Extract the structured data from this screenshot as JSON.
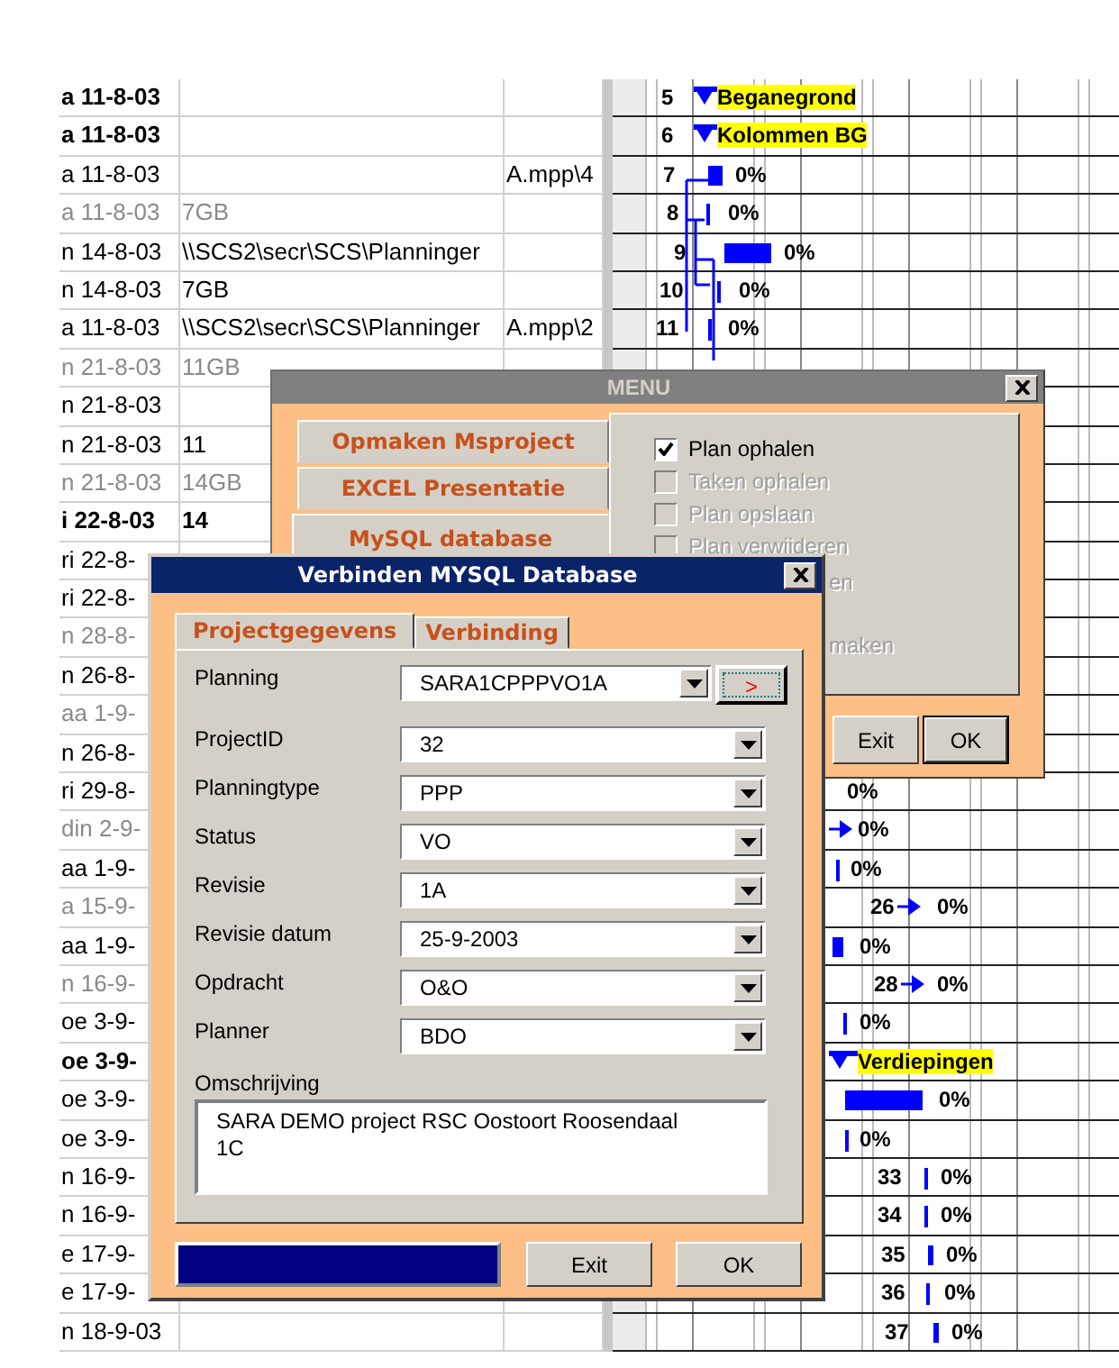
{
  "sheet": {
    "rows": [
      {
        "kind": "bold",
        "date": "a 11-8-03",
        "gantt": {
          "kind": "summary",
          "id": "5",
          "label": "Beganegrond"
        }
      },
      {
        "kind": "bold",
        "date": "a 11-8-03",
        "gantt": {
          "kind": "summary",
          "id": "6",
          "label": "Kolommen BG"
        }
      },
      {
        "kind": "plain",
        "date": "a 11-8-03",
        "file": "A.mpp\\4",
        "gantt": {
          "kind": "bar",
          "id": "7",
          "percent": "0%"
        }
      },
      {
        "kind": "dim",
        "date": "a 11-8-03",
        "path": "7GB",
        "gantt": {
          "kind": "tick",
          "id": "8",
          "percent": "0%"
        }
      },
      {
        "kind": "plain",
        "date": "n 14-8-03",
        "path": "\\\\SCS2\\secr\\SCS\\Planninger",
        "gantt": {
          "kind": "bar",
          "id": "9",
          "percent": "0%"
        }
      },
      {
        "kind": "plain",
        "date": "n 14-8-03",
        "path": "7GB",
        "gantt": {
          "kind": "tick",
          "id": "10",
          "percent": "0%"
        }
      },
      {
        "kind": "plain",
        "date": "a 11-8-03",
        "path": "\\\\SCS2\\secr\\SCS\\Planninger",
        "file": "A.mpp\\2",
        "gantt": {
          "kind": "tick",
          "id": "11",
          "percent": "0%"
        }
      },
      {
        "kind": "dim",
        "date": "n 21-8-03",
        "path": "11GB"
      },
      {
        "kind": "plain",
        "date": "n 21-8-03"
      },
      {
        "kind": "plain",
        "date": "n 21-8-03",
        "path": "11"
      },
      {
        "kind": "dim",
        "date": "n 21-8-03",
        "path": "14GB"
      },
      {
        "kind": "bold",
        "date": "i 22-8-03",
        "path": "14"
      },
      {
        "kind": "plain",
        "date": "ri 22-8-"
      },
      {
        "kind": "plain",
        "date": "ri 22-8-"
      },
      {
        "kind": "dim",
        "date": "n 28-8-"
      },
      {
        "kind": "plain",
        "date": "n 26-8-"
      },
      {
        "kind": "dim",
        "date": "aa 1-9-"
      },
      {
        "kind": "plain",
        "date": "n 26-8-"
      },
      {
        "kind": "plain",
        "date": "ri 29-8-",
        "gantt": {
          "kind": "none",
          "percent": "0%"
        }
      },
      {
        "kind": "dim",
        "date": "din 2-9-",
        "gantt": {
          "kind": "arrow",
          "percent": "0%"
        }
      },
      {
        "kind": "plain",
        "date": "aa 1-9-",
        "gantt": {
          "kind": "tick",
          "percent": "0%"
        }
      },
      {
        "kind": "dim",
        "date": "a 15-9-",
        "gantt": {
          "kind": "arrow",
          "id": "26",
          "percent": "0%"
        }
      },
      {
        "kind": "plain",
        "date": "aa 1-9-",
        "gantt": {
          "kind": "bar",
          "percent": "0%"
        }
      },
      {
        "kind": "dim",
        "date": "n 16-9-",
        "gantt": {
          "kind": "arrow",
          "id": "28",
          "percent": "0%"
        }
      },
      {
        "kind": "plain",
        "date": "oe 3-9-",
        "gantt": {
          "kind": "tick",
          "percent": "0%"
        }
      },
      {
        "kind": "bold",
        "date": "oe 3-9-",
        "gantt": {
          "kind": "summary",
          "label": "Verdiepingen"
        }
      },
      {
        "kind": "plain",
        "date": "oe 3-9-",
        "gantt": {
          "kind": "bar",
          "percent": "0%"
        }
      },
      {
        "kind": "plain",
        "date": "oe 3-9-",
        "gantt": {
          "kind": "tick",
          "percent": "0%"
        }
      },
      {
        "kind": "plain",
        "date": "n 16-9-",
        "gantt": {
          "kind": "tick",
          "id": "33",
          "percent": "0%"
        }
      },
      {
        "kind": "plain",
        "date": "n 16-9-",
        "gantt": {
          "kind": "tick",
          "id": "34",
          "percent": "0%"
        }
      },
      {
        "kind": "plain",
        "date": "e 17-9-",
        "gantt": {
          "kind": "bar",
          "id": "35",
          "percent": "0%"
        }
      },
      {
        "kind": "plain",
        "date": "e 17-9-",
        "gantt": {
          "kind": "tick",
          "id": "36",
          "percent": "0%"
        }
      },
      {
        "kind": "plain",
        "date": "n 18-9-03",
        "gantt": {
          "kind": "bar",
          "id": "37",
          "percent": "0%"
        }
      }
    ]
  },
  "menu": {
    "title": "MENU",
    "tabs": [
      {
        "label": "Opmaken Msproject",
        "selected": false
      },
      {
        "label": "EXCEL Presentatie",
        "selected": false
      },
      {
        "label": "MySQL database",
        "selected": true
      }
    ],
    "options": [
      {
        "kind": "checkbox",
        "label": "Plan ophalen",
        "checked": true,
        "disabled": false
      },
      {
        "kind": "checkbox",
        "label": "Taken ophalen",
        "checked": false,
        "disabled": true
      },
      {
        "kind": "checkbox",
        "label": "Plan opslaan",
        "checked": false,
        "disabled": true
      },
      {
        "kind": "checkbox",
        "label": "Plan verwijderen",
        "checked": false,
        "disabled": true
      },
      {
        "kind": "fragment",
        "label": "en"
      },
      {
        "kind": "fragment",
        "label": "maken"
      }
    ],
    "buttons": [
      {
        "label": "Exit",
        "default": false
      },
      {
        "label": "OK",
        "default": true
      }
    ]
  },
  "dialog": {
    "title": "Verbinden MYSQL Database",
    "tabs": [
      {
        "label": "Projectgegevens",
        "selected": true
      },
      {
        "label": "Verbinding",
        "selected": false
      }
    ],
    "fields": [
      {
        "label": "Planning",
        "value": "SARA1CPPPVO1A",
        "action": ">"
      },
      {
        "label": "ProjectID",
        "value": "32"
      },
      {
        "label": "Planningtype",
        "value": "PPP"
      },
      {
        "label": "Status",
        "value": "VO"
      },
      {
        "label": "Revisie",
        "value": "1A"
      },
      {
        "label": "Revisie datum",
        "value": "25-9-2003"
      },
      {
        "label": "Opdracht",
        "value": "O&O"
      },
      {
        "label": "Planner",
        "value": "BDO"
      }
    ],
    "description": {
      "label": "Omschrijving",
      "value": "SARA DEMO project RSC Oostoort Roosendaal\n1C"
    },
    "progress": {
      "level": 1
    },
    "buttons": [
      {
        "label": "Exit"
      },
      {
        "label": "OK"
      }
    ]
  }
}
